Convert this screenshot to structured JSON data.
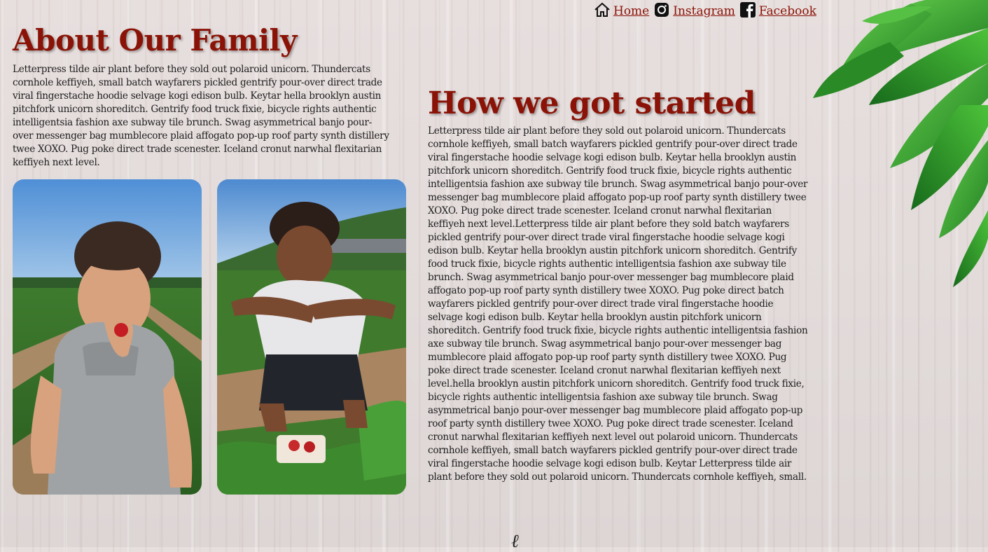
{
  "nav": {
    "items": [
      {
        "label": " Home",
        "icon": "home-icon"
      },
      {
        "label": " Instagram ",
        "icon": "instagram-icon"
      },
      {
        "label": " Facebook",
        "icon": "facebook-icon"
      }
    ],
    "link_color": "#8a1206"
  },
  "about": {
    "title": "About Our Family",
    "body": "Letterpress tilde air plant before they sold out polaroid unicorn. Thundercats cornhole keffiyeh, small batch wayfarers pickled gentrify pour-over direct trade viral fingerstache hoodie selvage kogi edison bulb. Keytar hella brooklyn austin pitchfork unicorn shoreditch. Gentrify food truck fixie, bicycle rights authentic intelligentsia fashion axe subway tile brunch. Swag asymmetrical banjo pour-over messenger bag mumblecore plaid affogato pop-up roof party synth distillery twee XOXO. Pug poke direct trade scenester. Iceland cronut narwhal flexitarian keffiyeh next level."
  },
  "started": {
    "title": "How we got started",
    "body": "Letterpress tilde air plant before they sold out polaroid unicorn. Thundercats cornhole keffiyeh, small batch wayfarers pickled gentrify pour-over direct trade viral fingerstache hoodie selvage kogi edison bulb. Keytar hella brooklyn austin pitchfork unicorn shoreditch. Gentrify food truck fixie, bicycle rights authentic intelligentsia fashion axe subway tile brunch. Swag asymmetrical banjo pour-over messenger bag mumblecore plaid affogato pop-up roof party synth distillery twee XOXO. Pug poke direct trade scenester. Iceland cronut narwhal flexitarian keffiyeh next level.Letterpress tilde air plant before they sold batch wayfarers pickled gentrify pour-over direct trade viral fingerstache hoodie selvage kogi edison bulb. Keytar hella brooklyn austin pitchfork unicorn shoreditch. Gentrify food truck fixie, bicycle rights authentic intelligentsia fashion axe subway tile brunch. Swag asymmetrical banjo pour-over messenger bag mumblecore plaid affogato pop-up roof party synth distillery twee XOXO. Pug poke direct batch wayfarers pickled gentrify pour-over direct trade viral fingerstache hoodie selvage kogi edison bulb. Keytar hella brooklyn austin pitchfork unicorn shoreditch. Gentrify food truck fixie, bicycle rights authentic intelligentsia fashion axe subway tile brunch. Swag asymmetrical banjo pour-over messenger bag mumblecore plaid affogato pop-up roof party synth distillery twee XOXO. Pug poke direct trade scenester. Iceland cronut narwhal flexitarian keffiyeh next level.hella brooklyn austin pitchfork unicorn shoreditch. Gentrify food truck fixie, bicycle rights authentic intelligentsia fashion axe subway tile brunch. Swag asymmetrical banjo pour-over messenger bag mumblecore plaid affogato pop-up roof party synth distillery twee XOXO. Pug poke direct trade scenester. Iceland cronut narwhal flexitarian keffiyeh next level out polaroid unicorn. Thundercats cornhole keffiyeh, small batch wayfarers pickled gentrify pour-over direct trade viral fingerstache hoodie selvage kogi edison bulb. Keytar Letterpress tilde air plant before they sold out polaroid unicorn. Thundercats cornhole keffiyeh, small."
  },
  "colors": {
    "heading": "#8a1206",
    "text": "#1d1d1d",
    "leaf": "#2e9a2a"
  },
  "footer": {
    "mark": "ℓ"
  }
}
